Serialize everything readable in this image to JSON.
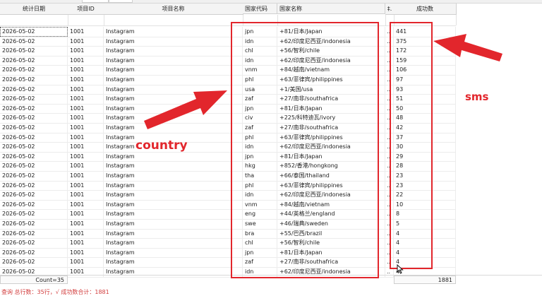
{
  "columns": [
    "统计日期",
    "项目ID",
    "项目名称",
    "国家代码",
    "国家名称",
    "‡.",
    "成功数"
  ],
  "rows": [
    [
      "2026-05-02",
      "1001",
      "Instagram",
      "jpn",
      "+81/日本/Japan",
      "441"
    ],
    [
      "2026-05-02",
      "1001",
      "Instagram",
      "idn",
      "+62/印度尼西亚/indonesia",
      "375"
    ],
    [
      "2026-05-02",
      "1001",
      "Instagram",
      "chl",
      "+56/智利/chile",
      "172"
    ],
    [
      "2026-05-02",
      "1001",
      "Instagram",
      "idn",
      "+62/印度尼西亚/indonesia",
      "159"
    ],
    [
      "2026-05-02",
      "1001",
      "Instagram",
      "vnm",
      "+84/越南/vietnam",
      "106"
    ],
    [
      "2026-05-02",
      "1001",
      "Instagram",
      "phl",
      "+63/菲律宾/philippines",
      "97"
    ],
    [
      "2026-05-02",
      "1001",
      "Instagram",
      "usa",
      "+1/美国/usa",
      "93"
    ],
    [
      "2026-05-02",
      "1001",
      "Instagram",
      "zaf",
      "+27/南非/southafrica",
      "51"
    ],
    [
      "2026-05-02",
      "1001",
      "Instagram",
      "jpn",
      "+81/日本/Japan",
      "50"
    ],
    [
      "2026-05-02",
      "1001",
      "Instagram",
      "civ",
      "+225/科特迪瓦/ivory",
      "48"
    ],
    [
      "2026-05-02",
      "1001",
      "Instagram",
      "zaf",
      "+27/南非/southafrica",
      "42"
    ],
    [
      "2026-05-02",
      "1001",
      "Instagram",
      "phl",
      "+63/菲律宾/philippines",
      "37"
    ],
    [
      "2026-05-02",
      "1001",
      "Instagram",
      "idn",
      "+62/印度尼西亚/indonesia",
      "30"
    ],
    [
      "2026-05-02",
      "1001",
      "Instagram",
      "jpn",
      "+81/日本/Japan",
      "29"
    ],
    [
      "2026-05-02",
      "1001",
      "Instagram",
      "hkg",
      "+852/香港/hongkong",
      "28"
    ],
    [
      "2026-05-02",
      "1001",
      "Instagram",
      "tha",
      "+66/泰国/thailand",
      "23"
    ],
    [
      "2026-05-02",
      "1001",
      "Instagram",
      "phl",
      "+63/菲律宾/philippines",
      "23"
    ],
    [
      "2026-05-02",
      "1001",
      "Instagram",
      "idn",
      "+62/印度尼西亚/indonesia",
      "22"
    ],
    [
      "2026-05-02",
      "1001",
      "Instagram",
      "vnm",
      "+84/越南/vietnam",
      "10"
    ],
    [
      "2026-05-02",
      "1001",
      "Instagram",
      "eng",
      "+44/英格兰/england",
      "8"
    ],
    [
      "2026-05-02",
      "1001",
      "Instagram",
      "swe",
      "+46/瑞典/sweden",
      "5"
    ],
    [
      "2026-05-02",
      "1001",
      "Instagram",
      "bra",
      "+55/巴西/brazil",
      "4"
    ],
    [
      "2026-05-02",
      "1001",
      "Instagram",
      "chl",
      "+56/智利/chile",
      "4"
    ],
    [
      "2026-05-02",
      "1001",
      "Instagram",
      "jpn",
      "+81/日本/Japan",
      "4"
    ],
    [
      "2026-05-02",
      "1001",
      "Instagram",
      "zaf",
      "+27/南非/southafrica",
      "4"
    ],
    [
      "2026-05-02",
      "1001",
      "Instagram",
      "idn",
      "+62/印度尼西亚/indonesia",
      "4"
    ]
  ],
  "truncated_cell": "..",
  "footer": {
    "count": "Count=35",
    "sum": "1881"
  },
  "status_text": "查询 总行数：35行，√ 成功数合计：1881",
  "annotations": {
    "country": "country",
    "sms": "sms"
  },
  "colors": {
    "annotation_red": "#e2262c",
    "status_red": "#d23c3c"
  },
  "icons": {
    "cursor": "mouse-cursor-icon"
  }
}
